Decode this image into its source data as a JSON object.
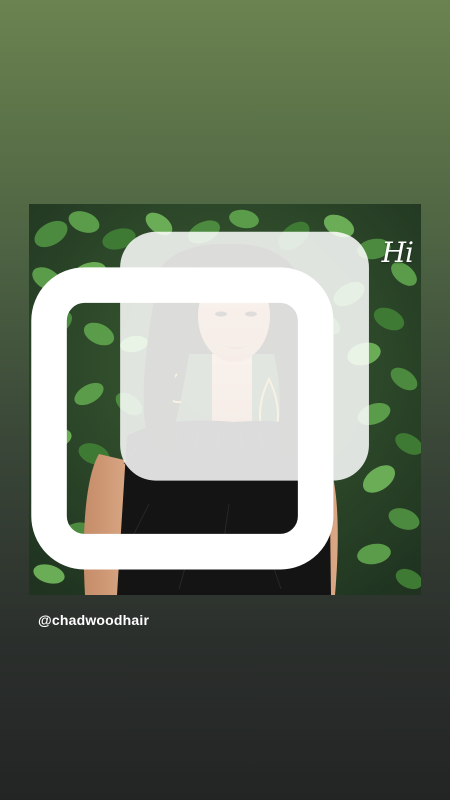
{
  "story": {
    "post": {
      "photo_subject": "woman-portrait",
      "corner_mark_text": "Hi",
      "badge_icon": "square-tag-icon"
    },
    "mention": "@chadwoodhair"
  },
  "colors": {
    "bg_top": "#6b8350",
    "bg_bottom": "#232525",
    "leaf": "#3f7a35",
    "hair": "#1a1412",
    "dress": "#141414"
  }
}
